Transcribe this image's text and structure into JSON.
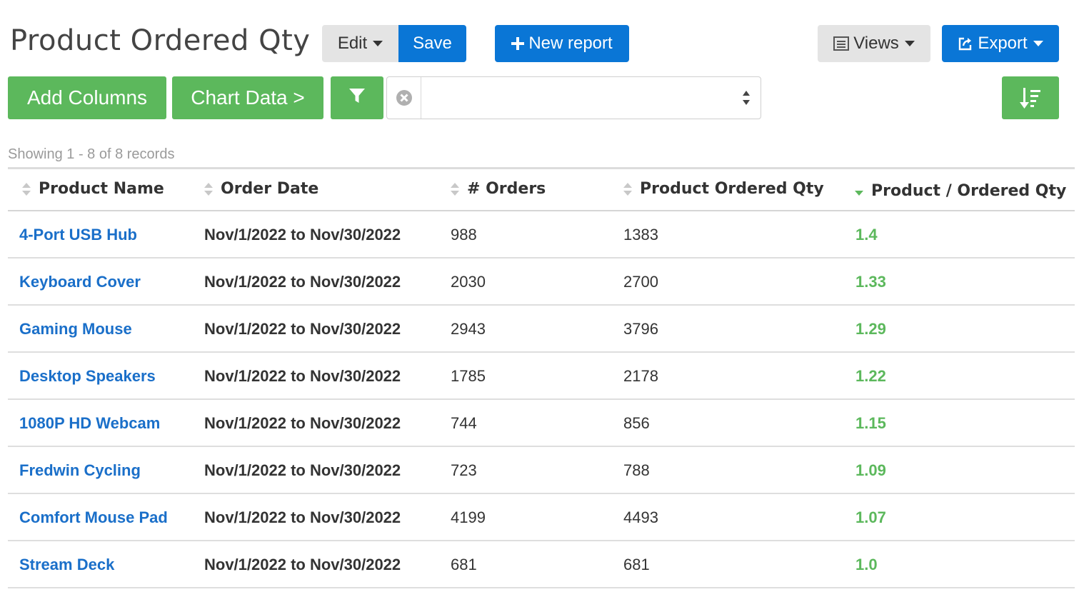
{
  "header": {
    "title": "Product Ordered Qty",
    "edit_label": "Edit",
    "save_label": "Save",
    "new_report_label": "New report",
    "views_label": "Views",
    "export_label": "Export"
  },
  "toolbar": {
    "add_columns_label": "Add Columns",
    "chart_data_label": "Chart Data >",
    "filter_select_value": ""
  },
  "status": {
    "showing": "Showing 1 - 8 of 8 records"
  },
  "table": {
    "columns": [
      "Product Name",
      "Order Date",
      "# Orders",
      "Product Ordered Qty",
      "Product / Ordered Qty"
    ],
    "sorted_column": "Product / Ordered Qty",
    "sort_direction": "descending",
    "rows": [
      {
        "name": "4-Port USB Hub",
        "date": "Nov/1/2022 to Nov/30/2022",
        "orders": "988",
        "qty": "1383",
        "ratio": "1.4"
      },
      {
        "name": "Keyboard Cover",
        "date": "Nov/1/2022 to Nov/30/2022",
        "orders": "2030",
        "qty": "2700",
        "ratio": "1.33"
      },
      {
        "name": "Gaming Mouse",
        "date": "Nov/1/2022 to Nov/30/2022",
        "orders": "2943",
        "qty": "3796",
        "ratio": "1.29"
      },
      {
        "name": "Desktop Speakers",
        "date": "Nov/1/2022 to Nov/30/2022",
        "orders": "1785",
        "qty": "2178",
        "ratio": "1.22"
      },
      {
        "name": "1080P HD Webcam",
        "date": "Nov/1/2022 to Nov/30/2022",
        "orders": "744",
        "qty": "856",
        "ratio": "1.15"
      },
      {
        "name": "Fredwin Cycling",
        "date": "Nov/1/2022 to Nov/30/2022",
        "orders": "723",
        "qty": "788",
        "ratio": "1.09"
      },
      {
        "name": "Comfort Mouse Pad",
        "date": "Nov/1/2022 to Nov/30/2022",
        "orders": "4199",
        "qty": "4493",
        "ratio": "1.07"
      },
      {
        "name": "Stream Deck",
        "date": "Nov/1/2022 to Nov/30/2022",
        "orders": "681",
        "qty": "681",
        "ratio": "1.0"
      }
    ]
  },
  "colors": {
    "primary_blue": "#0a76d6",
    "success_green": "#5cb85c",
    "link_blue": "#1a6fc9",
    "neutral_gray": "#e4e4e4"
  },
  "icons": {
    "new_report": "plus-icon",
    "views": "list-icon",
    "export": "share-icon",
    "filter": "funnel-icon",
    "clear": "clear-circle-icon",
    "sort": "sort-descending-icon"
  }
}
